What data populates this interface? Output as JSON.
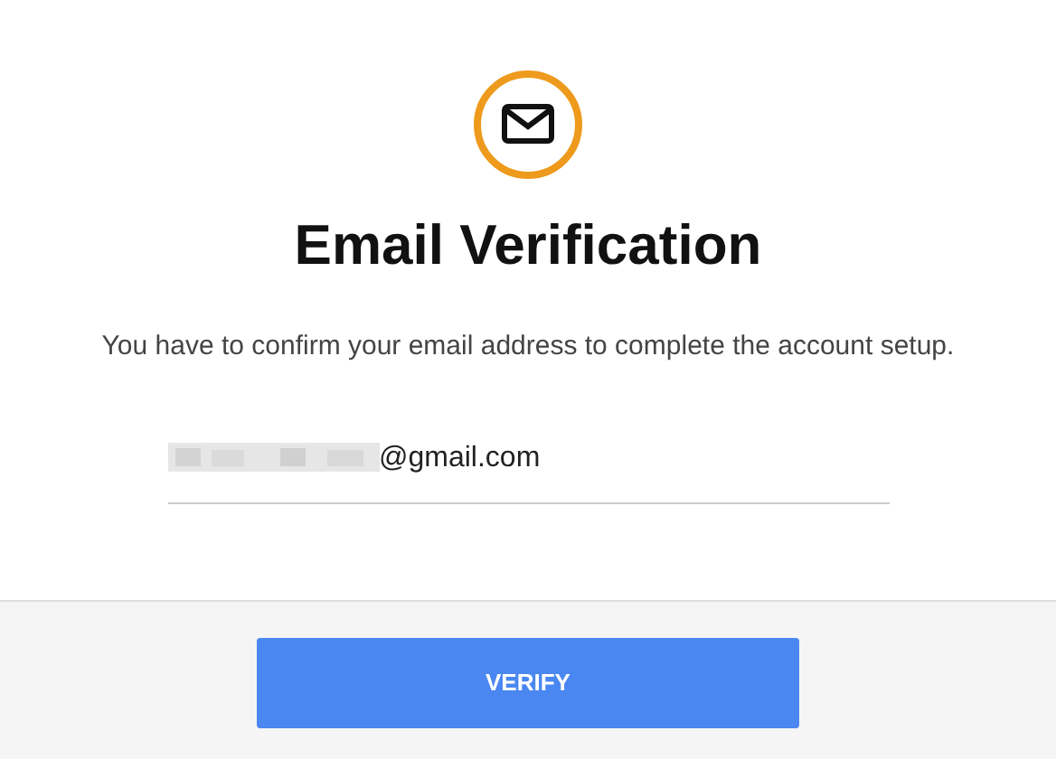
{
  "title": "Email Verification",
  "message": "You have to confirm your email address to complete the account setup.",
  "email_field": {
    "value": "@gmail.com"
  },
  "button": "VERIFY"
}
